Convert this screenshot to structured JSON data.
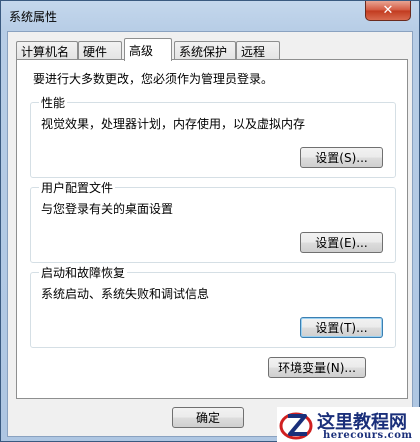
{
  "window": {
    "title": "系统属性",
    "close_label": "✕"
  },
  "tabs": [
    {
      "label": "计算机名"
    },
    {
      "label": "硬件"
    },
    {
      "label": "高级"
    },
    {
      "label": "系统保护"
    },
    {
      "label": "远程"
    }
  ],
  "active_tab": "高级",
  "panel": {
    "notice": "要进行大多数更改，您必须作为管理员登录。",
    "groups": [
      {
        "title": "性能",
        "desc": "视觉效果，处理器计划，内存使用，以及虚拟内存",
        "button": "设置(S)..."
      },
      {
        "title": "用户配置文件",
        "desc": "与您登录有关的桌面设置",
        "button": "设置(E)..."
      },
      {
        "title": "启动和故障恢复",
        "desc": "系统启动、系统失败和调试信息",
        "button": "设置(T)..."
      }
    ],
    "env_button": "环境变量(N)..."
  },
  "dialog_buttons": {
    "ok": "确定"
  },
  "watermark": {
    "name": "这里教程网",
    "url": "herecours.com"
  }
}
